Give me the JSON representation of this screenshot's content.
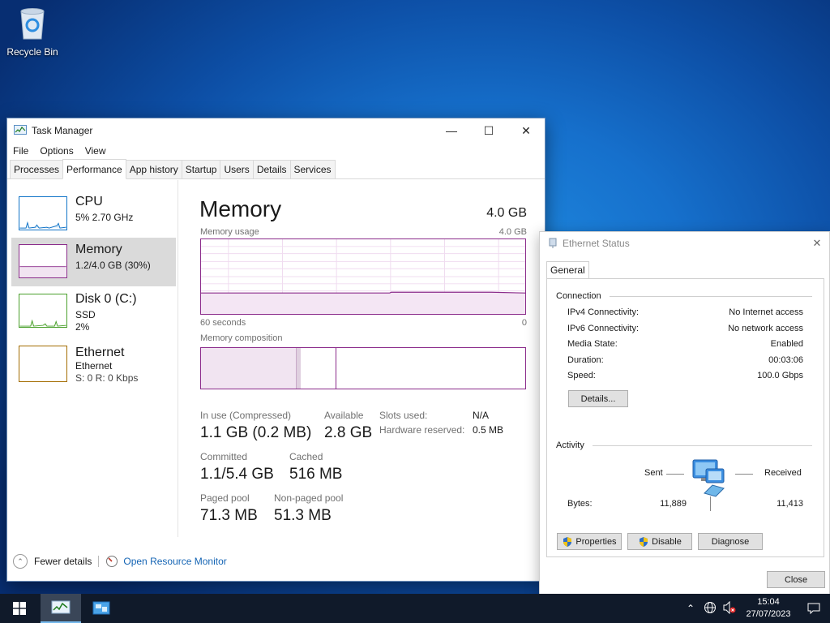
{
  "desktop": {
    "recycle_bin_label": "Recycle Bin"
  },
  "taskmanager": {
    "title": "Task Manager",
    "menu": [
      "File",
      "Options",
      "View"
    ],
    "tabs": [
      "Processes",
      "Performance",
      "App history",
      "Startup",
      "Users",
      "Details",
      "Services"
    ],
    "active_tab": "Performance",
    "sidebar": {
      "cpu": {
        "title": "CPU",
        "sub": "5%  2.70 GHz"
      },
      "memory": {
        "title": "Memory",
        "sub": "1.2/4.0 GB (30%)"
      },
      "disk": {
        "title": "Disk 0 (C:)",
        "sub1": "SSD",
        "sub2": "2%"
      },
      "ethernet": {
        "title": "Ethernet",
        "sub1": "Ethernet",
        "sub2": "S: 0 R: 0 Kbps"
      }
    },
    "main": {
      "heading": "Memory",
      "capacity": "4.0 GB",
      "usage_label": "Memory usage",
      "usage_max": "4.0 GB",
      "axis_left": "60 seconds",
      "axis_right": "0",
      "composition_label": "Memory composition",
      "usage_fraction": 0.3,
      "stats": {
        "in_use_label": "In use (Compressed)",
        "in_use_value": "1.1 GB (0.2 MB)",
        "available_label": "Available",
        "available_value": "2.8 GB",
        "committed_label": "Committed",
        "committed_value": "1.1/5.4 GB",
        "cached_label": "Cached",
        "cached_value": "516 MB",
        "paged_label": "Paged pool",
        "paged_value": "71.3 MB",
        "nonpaged_label": "Non-paged pool",
        "nonpaged_value": "51.3 MB",
        "slots_label": "Slots used:",
        "slots_value": "N/A",
        "hwres_label": "Hardware reserved:",
        "hwres_value": "0.5 MB"
      }
    },
    "footer": {
      "fewer_details": "Fewer details",
      "open_monitor": "Open Resource Monitor"
    }
  },
  "ethernet_status": {
    "title": "Ethernet Status",
    "tab": "General",
    "connection_label": "Connection",
    "rows": [
      {
        "label": "IPv4 Connectivity:",
        "value": "No Internet access"
      },
      {
        "label": "IPv6 Connectivity:",
        "value": "No network access"
      },
      {
        "label": "Media State:",
        "value": "Enabled"
      },
      {
        "label": "Duration:",
        "value": "00:03:06"
      },
      {
        "label": "Speed:",
        "value": "100.0 Gbps"
      }
    ],
    "details_button": "Details...",
    "activity_label": "Activity",
    "sent_label": "Sent",
    "received_label": "Received",
    "bytes_label": "Bytes:",
    "bytes_sent": "11,889",
    "bytes_received": "11,413",
    "properties_button": "Properties",
    "disable_button": "Disable",
    "diagnose_button": "Diagnose",
    "close_button": "Close"
  },
  "taskbar": {
    "time": "15:04",
    "date": "27/07/2023"
  },
  "colors": {
    "memory_accent": "#8b2c8b",
    "cpu_accent": "#1174c8",
    "disk_accent": "#4aa02c",
    "ethernet_accent": "#a36c00"
  }
}
